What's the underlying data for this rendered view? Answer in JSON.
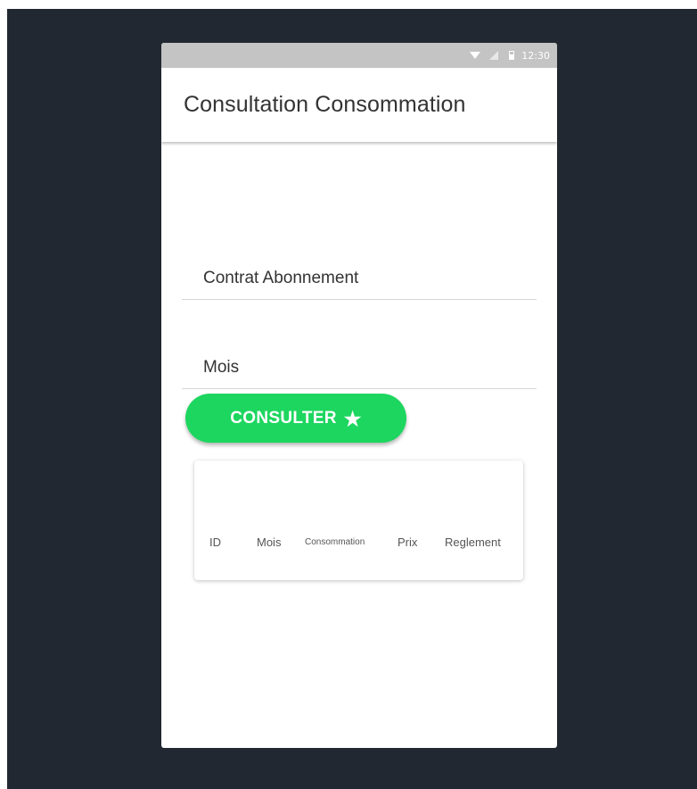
{
  "status_bar": {
    "time": "12:30",
    "icons": [
      "wifi-icon",
      "signal-icon",
      "battery-icon"
    ]
  },
  "app_bar": {
    "title": "Consultation Consommation"
  },
  "form": {
    "contrat_placeholder": "Contrat Abonnement",
    "mois_placeholder": "Mois"
  },
  "button": {
    "label": "CONSULTER",
    "icon": "star-icon",
    "color": "#1dd65f"
  },
  "table": {
    "headers": [
      "ID",
      "Mois",
      "Consommation",
      "Prix",
      "Reglement"
    ],
    "rows": []
  },
  "colors": {
    "backdrop": "#222831",
    "status_bar": "#c4c4c4",
    "accent": "#1dd65f"
  }
}
